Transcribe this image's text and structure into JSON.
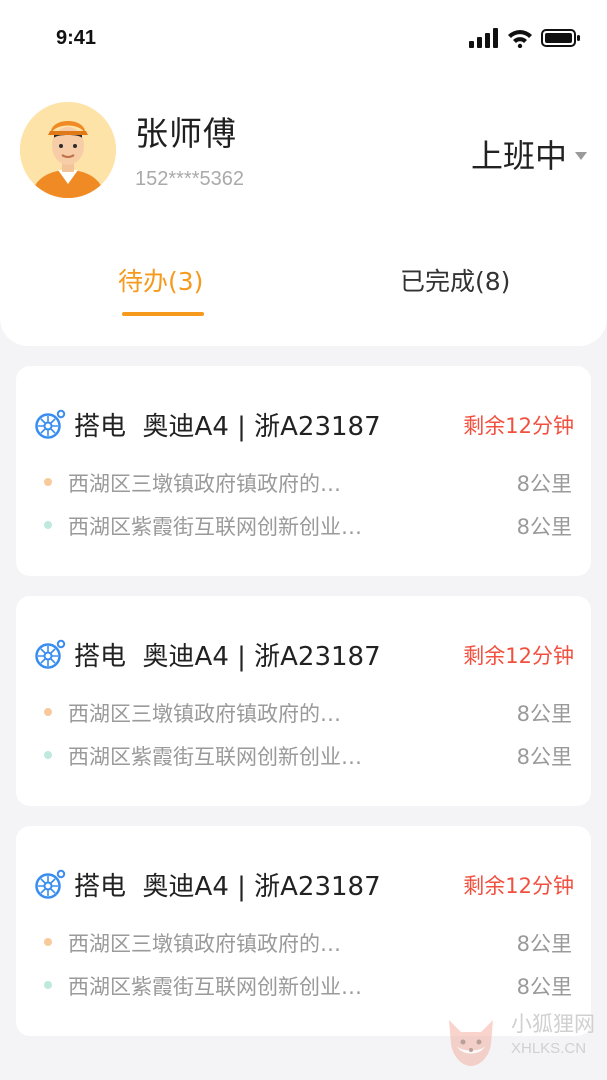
{
  "status_bar": {
    "time": "9:41"
  },
  "profile": {
    "name": "张师傅",
    "phone": "152****5362",
    "work_status": "上班中"
  },
  "tabs": [
    {
      "label": "待办(3)",
      "active": true
    },
    {
      "label": "已完成(8)",
      "active": false
    }
  ],
  "orders": [
    {
      "service_icon": "wheel-icon",
      "title": "搭电  奥迪A4 | 浙A23187",
      "remaining": "剩余12分钟",
      "from": {
        "address": "西湖区三墩镇政府镇政府的…",
        "distance": "8公里"
      },
      "to": {
        "address": "西湖区紫霞街互联网创新创业…",
        "distance": "8公里"
      }
    },
    {
      "service_icon": "wheel-icon",
      "title": "搭电  奥迪A4 | 浙A23187",
      "remaining": "剩余12分钟",
      "from": {
        "address": "西湖区三墩镇政府镇政府的…",
        "distance": "8公里"
      },
      "to": {
        "address": "西湖区紫霞街互联网创新创业…",
        "distance": "8公里"
      }
    },
    {
      "service_icon": "wheel-icon",
      "title": "搭电  奥迪A4 | 浙A23187",
      "remaining": "剩余12分钟",
      "from": {
        "address": "西湖区三墩镇政府镇政府的…",
        "distance": "8公里"
      },
      "to": {
        "address": "西湖区紫霞街互联网创新创业…",
        "distance": "8公里"
      }
    }
  ],
  "colors": {
    "accent": "#f59a1c",
    "remaining": "#f2503f",
    "from_dot": "#f8c99a",
    "to_dot": "#bfe9de",
    "icon_blue": "#3a8df0"
  },
  "watermark": {
    "cn": "小狐狸网",
    "en": "XHLKS.CN"
  }
}
